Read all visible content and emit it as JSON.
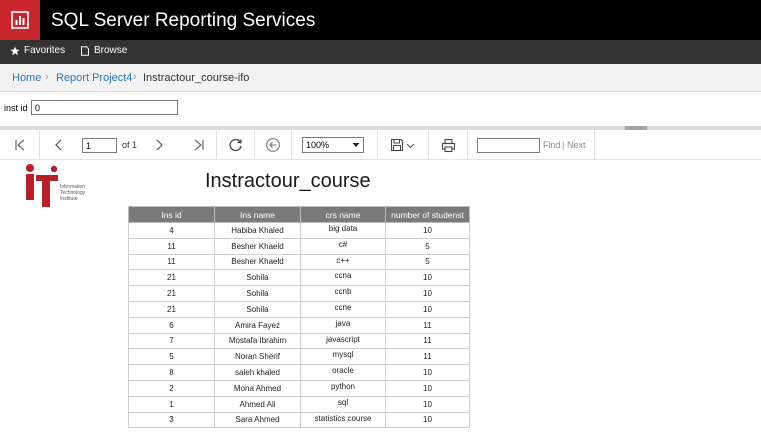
{
  "app": {
    "title": "SQL Server Reporting Services",
    "brand_color": "#c8262c"
  },
  "nav": {
    "favorites_label": "Favorites",
    "browse_label": "Browse"
  },
  "breadcrumb": {
    "home": "Home",
    "project": "Report Project4",
    "current": "Instractour_course-ifo"
  },
  "params": {
    "inst_id_label": "inst id",
    "inst_id_value": "0"
  },
  "toolbar": {
    "page_value": "1",
    "of_text": "of 1",
    "zoom_value": "100%",
    "find_label": "Find",
    "next_label": "Next"
  },
  "report": {
    "logo_lines": [
      "Information",
      "Technology",
      "Institute"
    ],
    "title": "Instractour_course",
    "columns": [
      "Ins id",
      "Ins name",
      "crs name",
      "number of studenst"
    ],
    "rows": [
      [
        "4",
        "Habiba Khaled",
        "big data",
        "10"
      ],
      [
        "11",
        "Besher Khaeld",
        "c#",
        "5"
      ],
      [
        "11",
        "Besher Khaeld",
        "c++",
        "5"
      ],
      [
        "21",
        "Sohila",
        "ccna",
        "10"
      ],
      [
        "21",
        "Sohila",
        "ccnb",
        "10"
      ],
      [
        "21",
        "Sohila",
        "ccne",
        "10"
      ],
      [
        "6",
        "Amira Fayez",
        "java",
        "11"
      ],
      [
        "7",
        "Mostafa Ibrahim",
        "javascript",
        "11"
      ],
      [
        "5",
        "Noran Sherif",
        "mysql",
        "11"
      ],
      [
        "8",
        "saleh khaled",
        "oracle",
        "10"
      ],
      [
        "2",
        "Mona Ahmed",
        "python",
        "10"
      ],
      [
        "1",
        "Ahmed Ali",
        "sql",
        "10"
      ],
      [
        "3",
        "Sara Ahmed",
        "statistics course",
        "10"
      ]
    ]
  }
}
